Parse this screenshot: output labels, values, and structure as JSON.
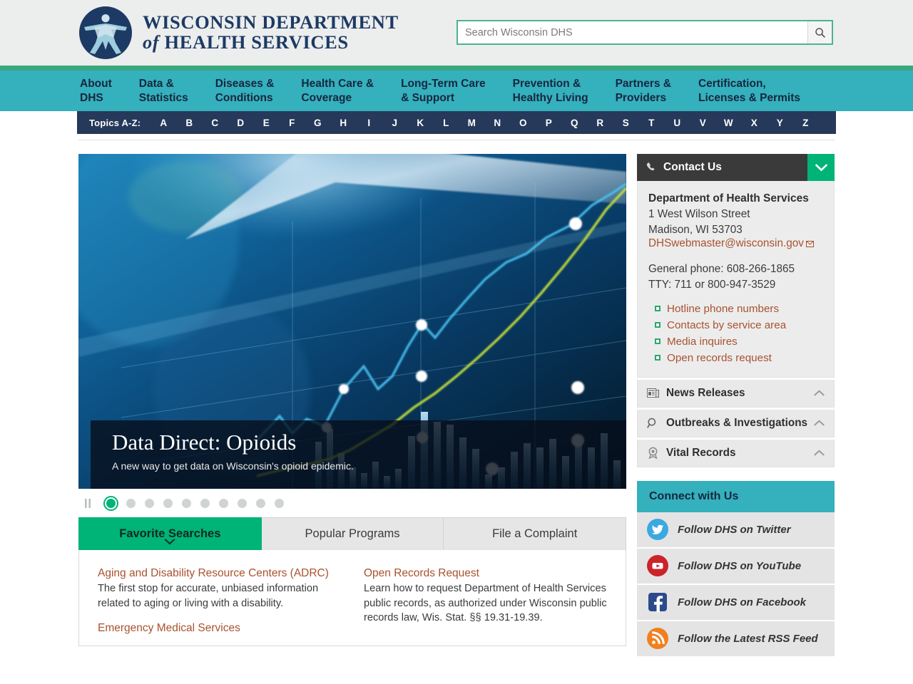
{
  "header": {
    "logo": {
      "icon": "dhs-person-seal-logo",
      "line1": "WISCONSIN DEPARTMENT",
      "of": "of",
      "line2": "HEALTH SERVICES"
    },
    "search": {
      "placeholder": "Search Wisconsin DHS",
      "value": "",
      "button_icon": "search-icon"
    }
  },
  "nav": {
    "items": [
      {
        "label": "About\nDHS"
      },
      {
        "label": "Data &\nStatistics"
      },
      {
        "label": "Diseases &\nConditions"
      },
      {
        "label": "Health Care &\nCoverage"
      },
      {
        "label": "Long-Term Care\n& Support"
      },
      {
        "label": "Prevention &\nHealthy Living"
      },
      {
        "label": "Partners &\nProviders"
      },
      {
        "label": "Certification,\nLicenses & Permits"
      }
    ]
  },
  "topics_az": {
    "label": "Topics A-Z:",
    "letters": [
      "A",
      "B",
      "C",
      "D",
      "E",
      "F",
      "G",
      "H",
      "I",
      "J",
      "K",
      "L",
      "M",
      "N",
      "O",
      "P",
      "Q",
      "R",
      "S",
      "T",
      "U",
      "V",
      "W",
      "X",
      "Y",
      "Z"
    ]
  },
  "hero": {
    "title": "Data Direct: Opioids",
    "subtitle": "A new way to get data on Wisconsin's opioid epidemic.",
    "image_alt": "abstract blue financial line and bar chart",
    "carousel": {
      "pause_icon": "pause-icon",
      "slide_count": 10,
      "active_index": 0
    }
  },
  "tabs": {
    "items": [
      {
        "label": "Favorite Searches",
        "active": true
      },
      {
        "label": "Popular Programs",
        "active": false
      },
      {
        "label": "File a Complaint",
        "active": false
      }
    ],
    "panel": {
      "left": [
        {
          "link": "Aging and Disability Resource Centers (ADRC)",
          "desc": "The first stop for accurate, unbiased information related to aging or living with a disability."
        },
        {
          "link": "Emergency Medical Services",
          "desc": ""
        }
      ],
      "right": [
        {
          "link": "Open Records Request",
          "desc": "Learn how to request Department of Health Services public records, as authorized under Wisconsin public records law, Wis. Stat. §§ 19.31-19.39."
        }
      ]
    }
  },
  "sidebar": {
    "contact": {
      "icon": "phone-icon",
      "title": "Contact Us",
      "toggle_icon": "chevron-down-icon",
      "org": "Department of Health Services",
      "address_line1": "1 West Wilson Street",
      "address_line2": "Madison, WI 53703",
      "email": "DHSwebmaster@wisconsin.gov",
      "email_icon": "envelope-icon",
      "general_phone": "General phone: 608-266-1865",
      "tty": "TTY: 711 or 800-947-3529",
      "links": [
        "Hotline phone numbers",
        "Contacts by service area",
        "Media inquires",
        "Open records request"
      ]
    },
    "accordions": [
      {
        "icon": "newspaper-icon",
        "label": "News Releases",
        "chevron": "chevron-up-icon"
      },
      {
        "icon": "magnifier-icon",
        "label": "Outbreaks & Investigations",
        "chevron": "chevron-up-icon"
      },
      {
        "icon": "award-seal-icon",
        "label": "Vital Records",
        "chevron": "chevron-up-icon"
      }
    ],
    "connect": {
      "title": "Connect with Us",
      "items": [
        {
          "icon": "twitter-icon",
          "label": "Follow DHS on Twitter",
          "color": "#3ba9e0"
        },
        {
          "icon": "youtube-icon",
          "label": "Follow DHS on YouTube",
          "color": "#cc2229"
        },
        {
          "icon": "facebook-icon",
          "label": "Follow DHS on Facebook",
          "color": "#2b4a8b"
        },
        {
          "icon": "rss-icon",
          "label": "Follow the Latest RSS Feed",
          "color": "#f08020"
        }
      ]
    }
  },
  "colors": {
    "teal": "#35b0bd",
    "green": "#00b377",
    "green_strip": "#3aa87e",
    "navy": "#26395a",
    "link": "#a9522f",
    "header_bg": "#eceded"
  }
}
